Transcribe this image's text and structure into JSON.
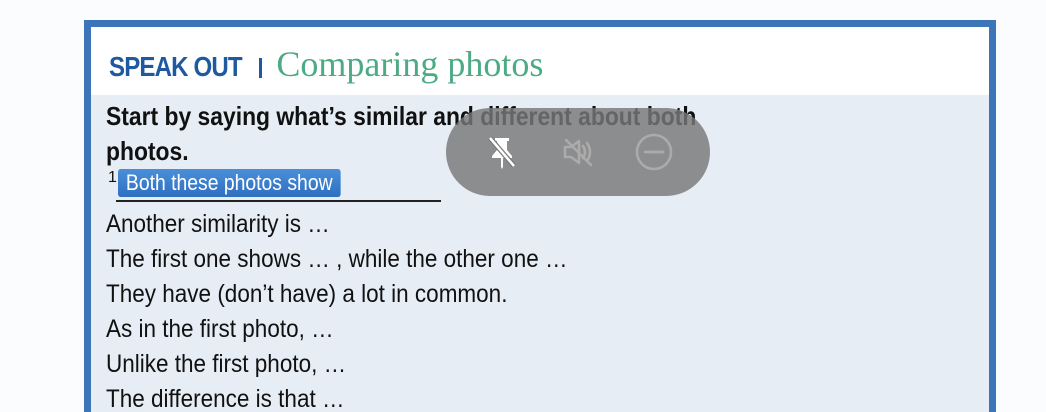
{
  "header": {
    "label": "SPEAK OUT",
    "title": "Comparing photos"
  },
  "instruction": "Start by saying what’s similar and different about both photos.",
  "gap": {
    "number": "1",
    "answer": "Both these photos show"
  },
  "phrases": [
    "Another similarity is …",
    "The first one shows … , while the other one …",
    "They have (don’t have) a lot in common.",
    "As in the first photo, …",
    "Unlike the first photo, …",
    "The difference is that …"
  ],
  "toolbar": {
    "icons": [
      "unpin-icon",
      "mute-icon",
      "minimize-icon"
    ]
  },
  "colors": {
    "frame": "#3c76b8",
    "label": "#1f5aa0",
    "title": "#4caa84",
    "highlight": "#3a7fcf"
  }
}
